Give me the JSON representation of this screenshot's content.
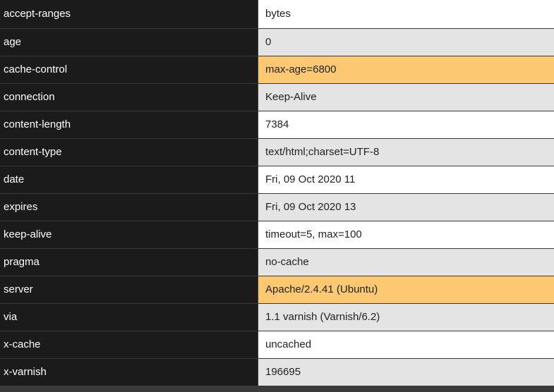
{
  "headers": [
    {
      "key": "accept-ranges",
      "value": "bytes",
      "bg": "white"
    },
    {
      "key": "age",
      "value": "0",
      "bg": "gray"
    },
    {
      "key": "cache-control",
      "value": "max-age=6800",
      "bg": "orange"
    },
    {
      "key": "connection",
      "value": "Keep-Alive",
      "bg": "gray"
    },
    {
      "key": "content-length",
      "value": "7384",
      "bg": "white"
    },
    {
      "key": "content-type",
      "value": "text/html;charset=UTF-8",
      "bg": "gray"
    },
    {
      "key": "date",
      "value": "Fri, 09 Oct 2020 11",
      "bg": "white"
    },
    {
      "key": "expires",
      "value": "Fri, 09 Oct 2020 13",
      "bg": "gray"
    },
    {
      "key": "keep-alive",
      "value": "timeout=5, max=100",
      "bg": "white"
    },
    {
      "key": "pragma",
      "value": "no-cache",
      "bg": "gray"
    },
    {
      "key": "server",
      "value": "Apache/2.4.41 (Ubuntu)",
      "bg": "orange"
    },
    {
      "key": "via",
      "value": "1.1 varnish (Varnish/6.2)",
      "bg": "gray"
    },
    {
      "key": "x-cache",
      "value": "uncached",
      "bg": "white"
    },
    {
      "key": "x-varnish",
      "value": "196695",
      "bg": "gray"
    }
  ]
}
